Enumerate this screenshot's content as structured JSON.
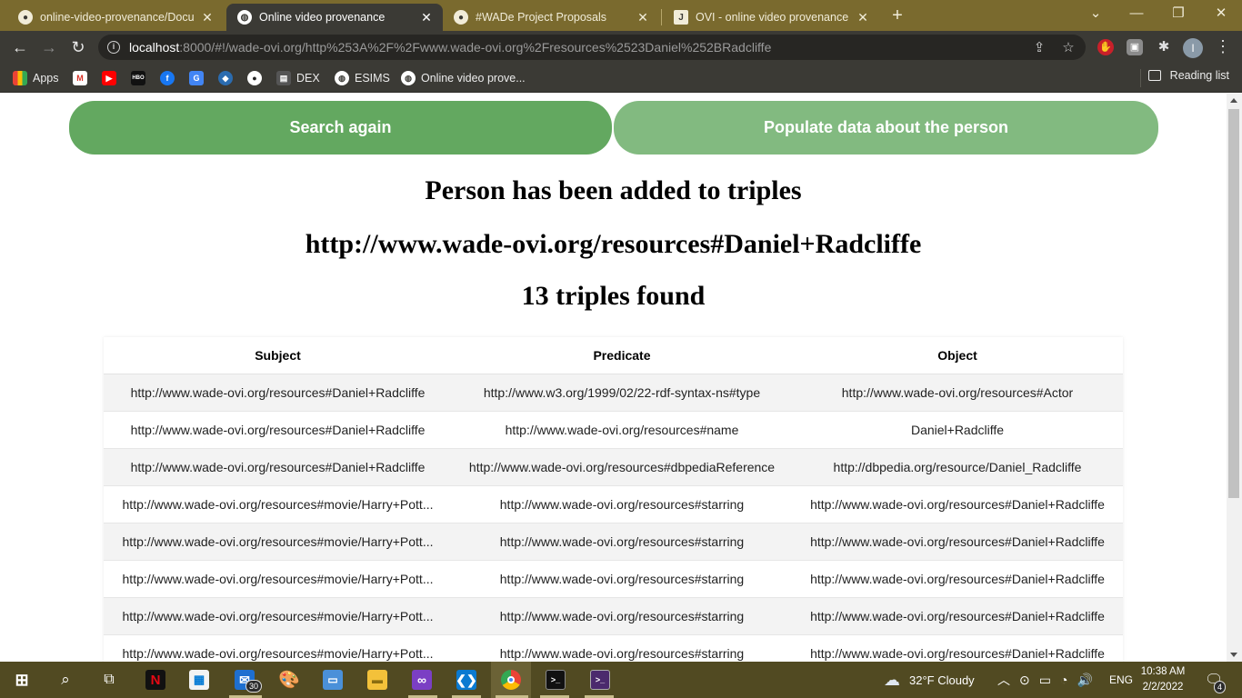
{
  "browser": {
    "tabs": [
      {
        "title": "online-video-provenance/Docum",
        "icon": "github-icon",
        "active": false
      },
      {
        "title": "Online video provenance",
        "icon": "globe-icon",
        "active": true
      },
      {
        "title": "#WADe Project Proposals",
        "icon": "github-icon",
        "active": false
      },
      {
        "title": "OVI - online video provenance - ",
        "icon": "j-icon",
        "active": false
      }
    ],
    "url_host": "localhost",
    "url_rest": ":8000/#!/wade-ovi.org/http%253A%2F%2Fwww.wade-ovi.org%2Fresources%2523Daniel%252BRadcliffe",
    "bookmarks": [
      {
        "label": "Apps",
        "icon": "apps-grid-icon"
      },
      {
        "label": "",
        "icon": "gmail-icon"
      },
      {
        "label": "",
        "icon": "youtube-icon"
      },
      {
        "label": "",
        "icon": "hbo-go-icon"
      },
      {
        "label": "",
        "icon": "facebook-icon"
      },
      {
        "label": "",
        "icon": "google-translate-icon"
      },
      {
        "label": "",
        "icon": "bookmark-icon"
      },
      {
        "label": "",
        "icon": "github-icon"
      },
      {
        "label": "DEX",
        "icon": "dex-icon"
      },
      {
        "label": "ESIMS",
        "icon": "globe-icon"
      },
      {
        "label": "Online video prove...",
        "icon": "globe-icon"
      }
    ],
    "reading_list": "Reading list",
    "profile_initial": "I"
  },
  "page": {
    "search_again": "Search again",
    "populate": "Populate data about the person",
    "heading_added": "Person has been added to triples",
    "heading_uri": "http://www.wade-ovi.org/resources#Daniel+Radcliffe",
    "heading_count": "13 triples found"
  },
  "table": {
    "headers": [
      "Subject",
      "Predicate",
      "Object"
    ],
    "rows": [
      [
        "http://www.wade-ovi.org/resources#Daniel+Radcliffe",
        "http://www.w3.org/1999/02/22-rdf-syntax-ns#type",
        "http://www.wade-ovi.org/resources#Actor"
      ],
      [
        "http://www.wade-ovi.org/resources#Daniel+Radcliffe",
        "http://www.wade-ovi.org/resources#name",
        "Daniel+Radcliffe"
      ],
      [
        "http://www.wade-ovi.org/resources#Daniel+Radcliffe",
        "http://www.wade-ovi.org/resources#dbpediaReference",
        "http://dbpedia.org/resource/Daniel_Radcliffe"
      ],
      [
        "http://www.wade-ovi.org/resources#movie/Harry+Pott...",
        "http://www.wade-ovi.org/resources#starring",
        "http://www.wade-ovi.org/resources#Daniel+Radcliffe"
      ],
      [
        "http://www.wade-ovi.org/resources#movie/Harry+Pott...",
        "http://www.wade-ovi.org/resources#starring",
        "http://www.wade-ovi.org/resources#Daniel+Radcliffe"
      ],
      [
        "http://www.wade-ovi.org/resources#movie/Harry+Pott...",
        "http://www.wade-ovi.org/resources#starring",
        "http://www.wade-ovi.org/resources#Daniel+Radcliffe"
      ],
      [
        "http://www.wade-ovi.org/resources#movie/Harry+Pott...",
        "http://www.wade-ovi.org/resources#starring",
        "http://www.wade-ovi.org/resources#Daniel+Radcliffe"
      ],
      [
        "http://www.wade-ovi.org/resources#movie/Harry+Pott...",
        "http://www.wade-ovi.org/resources#starring",
        "http://www.wade-ovi.org/resources#Daniel+Radcliffe"
      ]
    ]
  },
  "taskbar": {
    "mail_badge": "30",
    "weather": "32°F  Cloudy",
    "lang": "ENG",
    "time": "10:38 AM",
    "date": "2/2/2022",
    "notifications": "4"
  },
  "colors": {
    "primary_button": "#63a860",
    "secondary_button": "#82ba80",
    "tabbar": "#7a6a2e",
    "taskbar": "#514a22"
  }
}
